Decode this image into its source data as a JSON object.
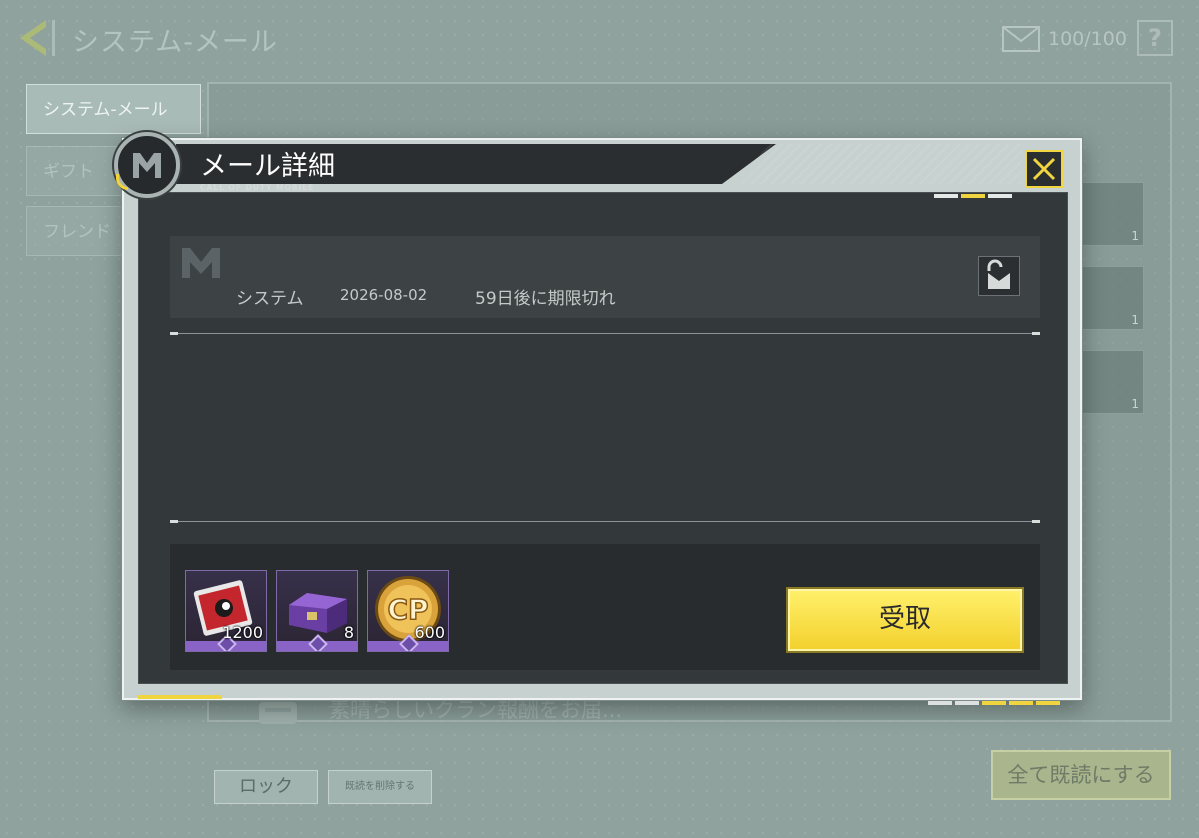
{
  "header": {
    "title": "システム-メール",
    "mail_count": "100/100",
    "help_label": "?"
  },
  "sidebar": {
    "tabs": [
      {
        "label": "システム-メール"
      },
      {
        "label": "ギフト"
      },
      {
        "label": "フレンド"
      }
    ]
  },
  "mail_list": {
    "items": [
      {
        "title": "素晴らしいクラン報酬をお届..."
      }
    ]
  },
  "background_rewards": [
    {
      "qty": "1"
    },
    {
      "qty": "1"
    },
    {
      "qty": "1"
    }
  ],
  "footer": {
    "lock_label": "ロック",
    "unlock_label": "既読を削除する",
    "read_all_label": "全て既読にする"
  },
  "dialog": {
    "title": "メール詳細",
    "subtitle": "CALL OF DUTY MOBILE",
    "sender": "システム",
    "date": "2026-08-02",
    "expire": "59日後に期限切れ",
    "body": "",
    "rewards": [
      {
        "icon": "card-ticket-icon",
        "qty": "1200"
      },
      {
        "icon": "purple-crate-icon",
        "qty": "8"
      },
      {
        "icon": "cp-coin-icon",
        "qty": "600"
      }
    ],
    "claim_label": "受取"
  },
  "colors": {
    "accent": "#f0d440",
    "dialog_bg": "#33383b",
    "overlay_bg": "#8fa29d",
    "reward_rarity": "#8a63c7"
  }
}
